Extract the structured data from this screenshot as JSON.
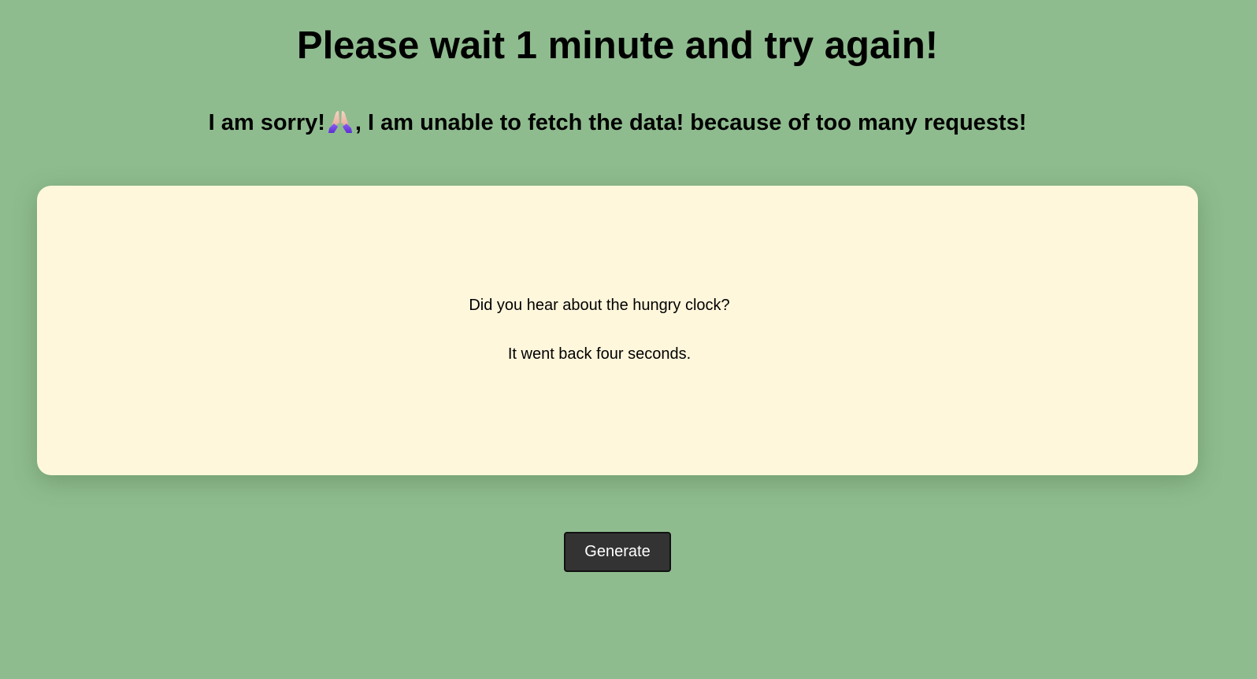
{
  "heading": {
    "title": "Please wait 1 minute and try again!",
    "subtitle_before": "I am sorry!",
    "subtitle_after": ", I am unable to fetch the data! because of too many requests!",
    "emoji_icon": "folded-hands-icon"
  },
  "joke": {
    "setup": "Did you hear about the hungry clock?",
    "punchline": "It went back four seconds."
  },
  "actions": {
    "generate_label": "Generate"
  },
  "colors": {
    "background": "#8fbc8f",
    "card": "#fff7dc",
    "button": "#333333",
    "button_text": "#ffffff"
  }
}
